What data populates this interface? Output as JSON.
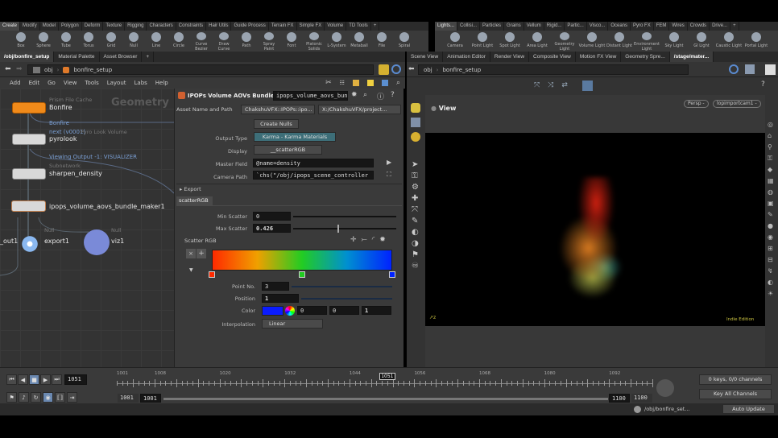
{
  "shelf_left": {
    "tabs": [
      "Create",
      "Modify",
      "Model",
      "Polygon",
      "Deform",
      "Texture",
      "Rigging",
      "Characters",
      "Constraints",
      "Hair Utils",
      "Guide Process",
      "Terrain FX",
      "Simple FX",
      "Volume",
      "TD Tools"
    ],
    "tools": [
      "Box",
      "Sphere",
      "Tube",
      "Torus",
      "Grid",
      "Null",
      "Line",
      "Circle",
      "Curve Bezier",
      "Draw Curve",
      "Path",
      "Spray Paint",
      "Font",
      "Platonic Solids",
      "L-System",
      "Metaball",
      "File",
      "Spiral"
    ]
  },
  "shelf_right": {
    "tabs": [
      "Lights...",
      "Collisi...",
      "Particles",
      "Grains",
      "Vellum",
      "Rigid...",
      "Partic...",
      "Visco...",
      "Oceans",
      "Pyro FX",
      "FEM",
      "Wires",
      "Crowds",
      "Drive..."
    ],
    "tools": [
      "Camera",
      "Point Light",
      "Spot Light",
      "Area Light",
      "Geometry Light",
      "Volume Light",
      "Distant Light",
      "Environment Light",
      "Sky Light",
      "GI Light",
      "Caustic Light",
      "Portal Light"
    ]
  },
  "left_tabs": [
    "/obj/bonfire_setup",
    "Material Palette",
    "Asset Browser"
  ],
  "right_tabs": [
    "Scene View",
    "Animation Editor",
    "Render View",
    "Composite View",
    "Motion FX View",
    "Geometry Spre...",
    "/stage/mater..."
  ],
  "path": {
    "root": "obj",
    "current": "bonfire_setup"
  },
  "menu": [
    "Add",
    "Edit",
    "Go",
    "View",
    "Tools",
    "Layout",
    "Labs",
    "Help"
  ],
  "network": {
    "watermark": "Geometry",
    "nodes": [
      {
        "type": "Prism File Cache",
        "name": "Bonfire",
        "sub1": "Bonfire",
        "sub2": "next (v0001)"
      },
      {
        "type": "Pyro Look Volume",
        "name": "pyrolook",
        "sub1": "Viewing Output -1: VISUALIZER"
      },
      {
        "type": "Subnetwork",
        "name": "sharpen_density"
      },
      {
        "type": "",
        "name": "ipops_volume_aovs_bundle_maker1"
      },
      {
        "type": "Null",
        "name": "export1",
        "left": "_out1"
      },
      {
        "type": "Null",
        "name": "viz1"
      }
    ]
  },
  "params": {
    "title": "IPOPs Volume AOVs Bundle...",
    "node_name": "ipops_volume_aovs_bun",
    "asset_label": "Asset Name and Path",
    "asset_name": "ChakshuVFX::IPOPs::ipo...",
    "asset_path": "X:/ChakshuVFX/project...",
    "create_nulls": "Create Nulls",
    "output_type_label": "Output Type",
    "output_type": "Karma - Karma Materials",
    "display_label": "Display",
    "display": "__scatterRGB",
    "master_field_label": "Master Field",
    "master_field": "@name=density",
    "camera_path_label": "Camera Path",
    "camera_path": "`chs(\"/obj/ipops_scene_controller",
    "export": "Export",
    "section_tab": "scatterRGB",
    "min_scatter_label": "Min Scatter",
    "min_scatter": "0",
    "max_scatter_label": "Max Scatter",
    "max_scatter": "0.426",
    "max_scatter_fraction": 0.426,
    "ramp_label": "Scatter RGB",
    "ramp_keys": [
      {
        "pos": 0,
        "color": "#ff2a00"
      },
      {
        "pos": 0.5,
        "color": "#22cc22"
      },
      {
        "pos": 1,
        "color": "#0022ff"
      }
    ],
    "point_no_label": "Point No.",
    "point_no": "3",
    "position_label": "Position",
    "position": "1",
    "color_label": "Color",
    "color_r": "0",
    "color_g": "0",
    "color_b": "1",
    "color_swatch": "#0a1cff",
    "interp_label": "Interpolation",
    "interp": "Linear"
  },
  "viewport": {
    "title": "View",
    "camera": "Persp -",
    "cam2": "lopimportcam1 -",
    "edition": "Indie Edition"
  },
  "timeline": {
    "frame": "1051",
    "marker": "1051",
    "ticks": [
      "1001",
      "1008",
      "1020",
      "1032",
      "1044",
      "1056",
      "1068",
      "1080",
      "1092"
    ],
    "start": "1001",
    "start2": "1001",
    "end": "1100",
    "end2": "1100",
    "keys": "0 keys, 0/0 channels",
    "key_all": "Key All Channels"
  },
  "status": {
    "path": "/obj/bonfire_set...",
    "update": "Auto Update"
  }
}
